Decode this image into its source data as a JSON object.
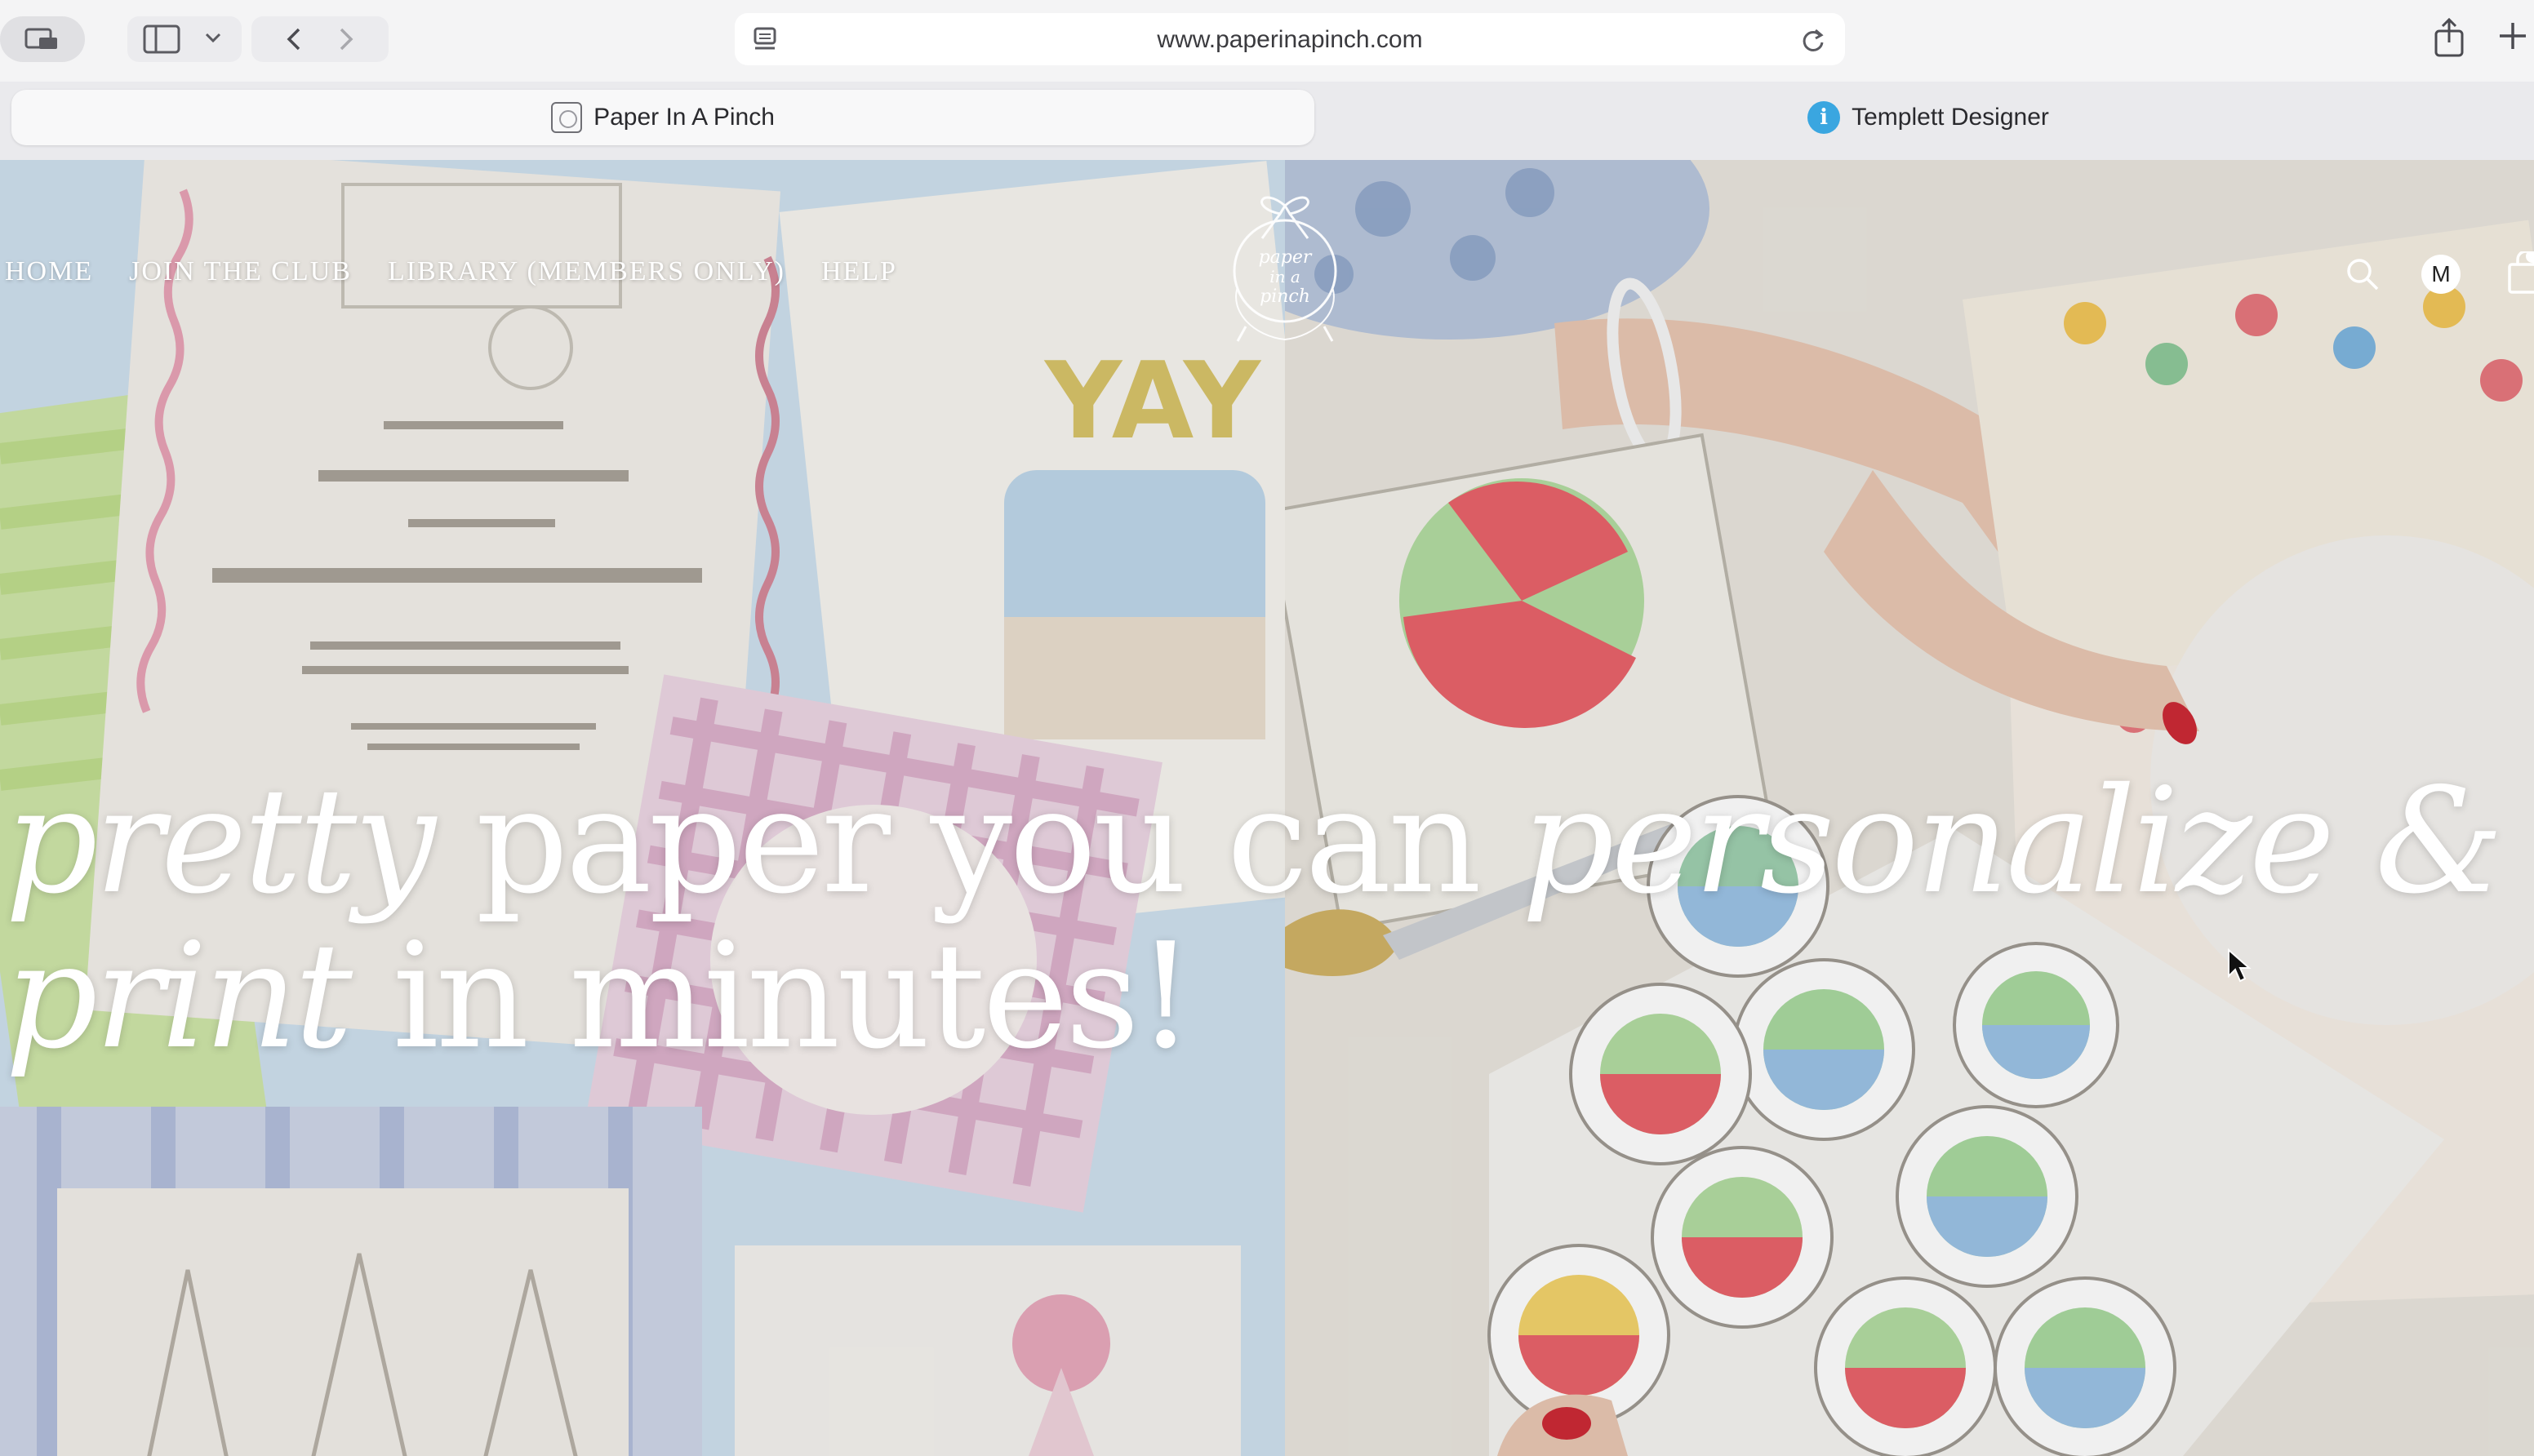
{
  "browser": {
    "url": "www.paperinapinch.com",
    "tabs": [
      {
        "title": "Paper In A Pinch",
        "active": true,
        "icon": "paper-in-a-pinch-favicon"
      },
      {
        "title": "Templett Designer",
        "active": false,
        "icon": "templett-favicon"
      }
    ]
  },
  "site": {
    "nav": [
      "HOME",
      "JOIN THE CLUB",
      "LIBRARY (MEMBERS ONLY)",
      "HELP"
    ],
    "logo_text": "paper in a pinch",
    "account_initial": "M",
    "icons": [
      "search-icon",
      "account-avatar",
      "shopping-bag-icon"
    ]
  },
  "hero": {
    "parts": [
      {
        "text": "pretty",
        "italic": true
      },
      {
        "text": " paper you can ",
        "italic": false
      },
      {
        "text": "personalize &",
        "italic": true
      },
      {
        "text": "print",
        "italic": true
      },
      {
        "text": " in minutes!",
        "italic": false
      }
    ]
  },
  "colors": {
    "chrome": "#f4f4f5",
    "tab_strip": "#eaeaed",
    "templett_accent": "#3aa6e0",
    "hero_text": "#ffffff"
  }
}
